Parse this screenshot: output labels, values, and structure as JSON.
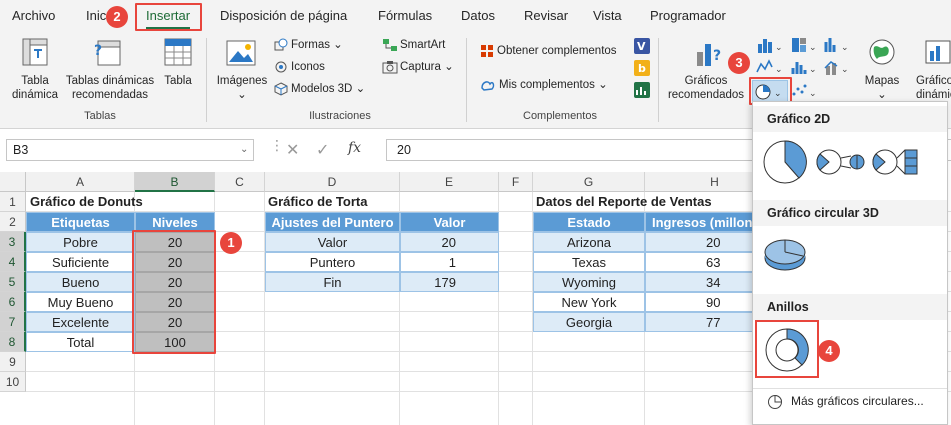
{
  "tabs": [
    "Archivo",
    "Inicio",
    "Insertar",
    "Disposición de página",
    "Fórmulas",
    "Datos",
    "Revisar",
    "Vista",
    "Programador"
  ],
  "tab_visible": {
    "inicio": "Inic"
  },
  "ribbon": {
    "tablas": {
      "tabla_dinamica": [
        "Tabla",
        "dinámica"
      ],
      "tablas_recomendadas": [
        "Tablas dinámicas",
        "recomendadas"
      ],
      "tabla": "Tabla",
      "group": "Tablas"
    },
    "ilustraciones": {
      "imagenes": "Imágenes",
      "formas": "Formas",
      "iconos": "Iconos",
      "modelos3d": "Modelos 3D",
      "smartart": "SmartArt",
      "captura": "Captura",
      "group": "Ilustraciones"
    },
    "complementos": {
      "obtener": "Obtener complementos",
      "mis": "Mis complementos",
      "group": "Complementos"
    },
    "graficos": {
      "recomendados": [
        "Gráficos",
        "recomendados"
      ],
      "mapas": "Mapas",
      "dinamico": [
        "Gráfico",
        "dinámico"
      ]
    }
  },
  "formula_bar": {
    "namebox": "B3",
    "fx": "fx",
    "value": "20"
  },
  "columns": [
    "A",
    "B",
    "C",
    "D",
    "E",
    "F",
    "G",
    "H"
  ],
  "rows": [
    "1",
    "2",
    "3",
    "4",
    "5",
    "6",
    "7",
    "8",
    "9",
    "10"
  ],
  "donut_table": {
    "title": "Gráfico de Donuts",
    "headers": [
      "Etiquetas",
      "Niveles"
    ],
    "rows": [
      [
        "Pobre",
        "20"
      ],
      [
        "Suficiente",
        "20"
      ],
      [
        "Bueno",
        "20"
      ],
      [
        "Muy Bueno",
        "20"
      ],
      [
        "Excelente",
        "20"
      ]
    ],
    "total": [
      "Total",
      "100"
    ]
  },
  "pie_table": {
    "title": "Gráfico de Torta",
    "headers": [
      "Ajustes del Puntero",
      "Valor"
    ],
    "rows": [
      [
        "Valor",
        "20"
      ],
      [
        "Puntero",
        "1"
      ],
      [
        "Fin",
        "179"
      ]
    ]
  },
  "sales_table": {
    "title": "Datos del Reporte de Ventas",
    "headers": [
      "Estado",
      "Ingresos (millon"
    ],
    "rows": [
      [
        "Arizona",
        "20"
      ],
      [
        "Texas",
        "63"
      ],
      [
        "Wyoming",
        "34"
      ],
      [
        "New York",
        "90"
      ],
      [
        "Georgia",
        "77"
      ]
    ]
  },
  "dropdown": {
    "section1": "Gráfico 2D",
    "section2": "Gráfico circular 3D",
    "section3": "Anillos",
    "more": "Más gráficos circulares..."
  },
  "badges": [
    "1",
    "2",
    "3",
    "4"
  ],
  "colors": {
    "accent": "#217346",
    "table_header": "#5b9bd5",
    "table_band": "#ddebf7",
    "annotation": "#e8453c",
    "chart_blue": "#5b9bd5"
  }
}
